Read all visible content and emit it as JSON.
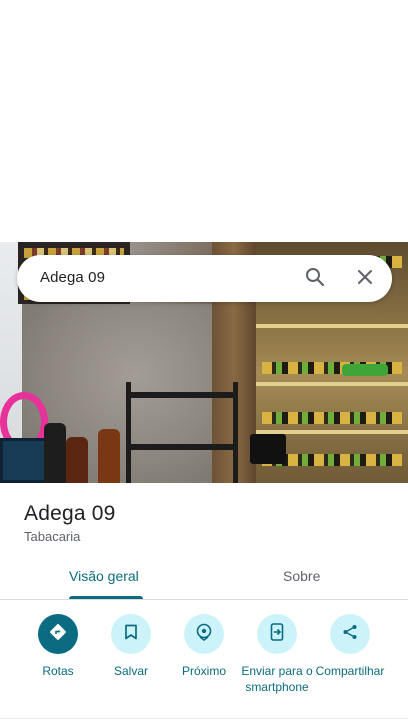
{
  "search": {
    "query": "Adega 09",
    "search_icon": "search-icon",
    "close_icon": "close-icon"
  },
  "place": {
    "name": "Adega 09",
    "category": "Tabacaria"
  },
  "tabs": [
    {
      "label": "Visão geral",
      "active": true
    },
    {
      "label": "Sobre",
      "active": false
    }
  ],
  "actions": [
    {
      "label": "Rotas",
      "icon": "directions-icon"
    },
    {
      "label": "Salvar",
      "icon": "bookmark-icon"
    },
    {
      "label": "Próximo",
      "icon": "nearby-icon"
    },
    {
      "label": "Enviar para o smartphone",
      "icon": "send-to-phone-icon"
    },
    {
      "label": "Compartilhar",
      "icon": "share-icon"
    }
  ],
  "colors": {
    "accent": "#0b6b80",
    "accent_light": "#cdf3fa",
    "text_primary": "#202124",
    "text_secondary": "#5f6368"
  }
}
